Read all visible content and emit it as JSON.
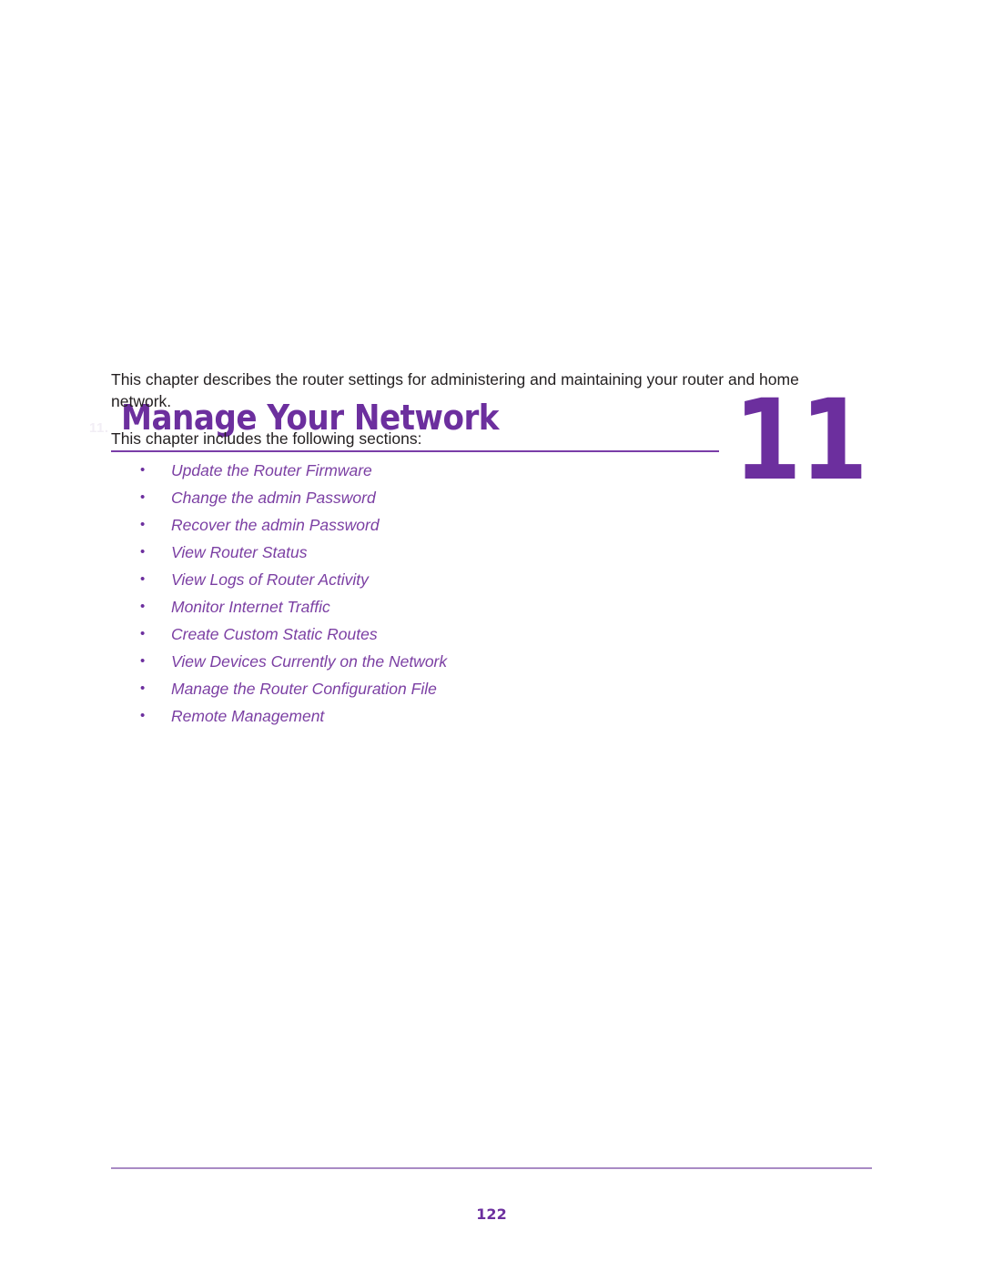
{
  "document": {
    "background_color": "#ffffff",
    "accent_color": "#6c2f9e",
    "link_color": "#7b3fa3",
    "body_text_color": "#231f20",
    "rule_color": "#7a3da8",
    "footer_rule_color": "#a98bc4"
  },
  "header": {
    "ghost_marker": "11.",
    "title": "Manage Your Network",
    "chapter_number": "11"
  },
  "intro": {
    "paragraph_1": "This chapter describes the router settings for administering and maintaining your router and home network.",
    "paragraph_2": "This chapter includes the following sections:"
  },
  "section_list": {
    "bullet_glyph": "•",
    "items": [
      {
        "label": "Update the Router Firmware"
      },
      {
        "label": "Change the admin Password"
      },
      {
        "label": "Recover the admin Password"
      },
      {
        "label": "View Router Status"
      },
      {
        "label": "View Logs of Router Activity"
      },
      {
        "label": "Monitor Internet Traffic"
      },
      {
        "label": "Create Custom Static Routes"
      },
      {
        "label": "View Devices Currently on the Network"
      },
      {
        "label": "Manage the Router Configuration File"
      },
      {
        "label": "Remote Management"
      }
    ]
  },
  "footer": {
    "page_number": "122"
  }
}
